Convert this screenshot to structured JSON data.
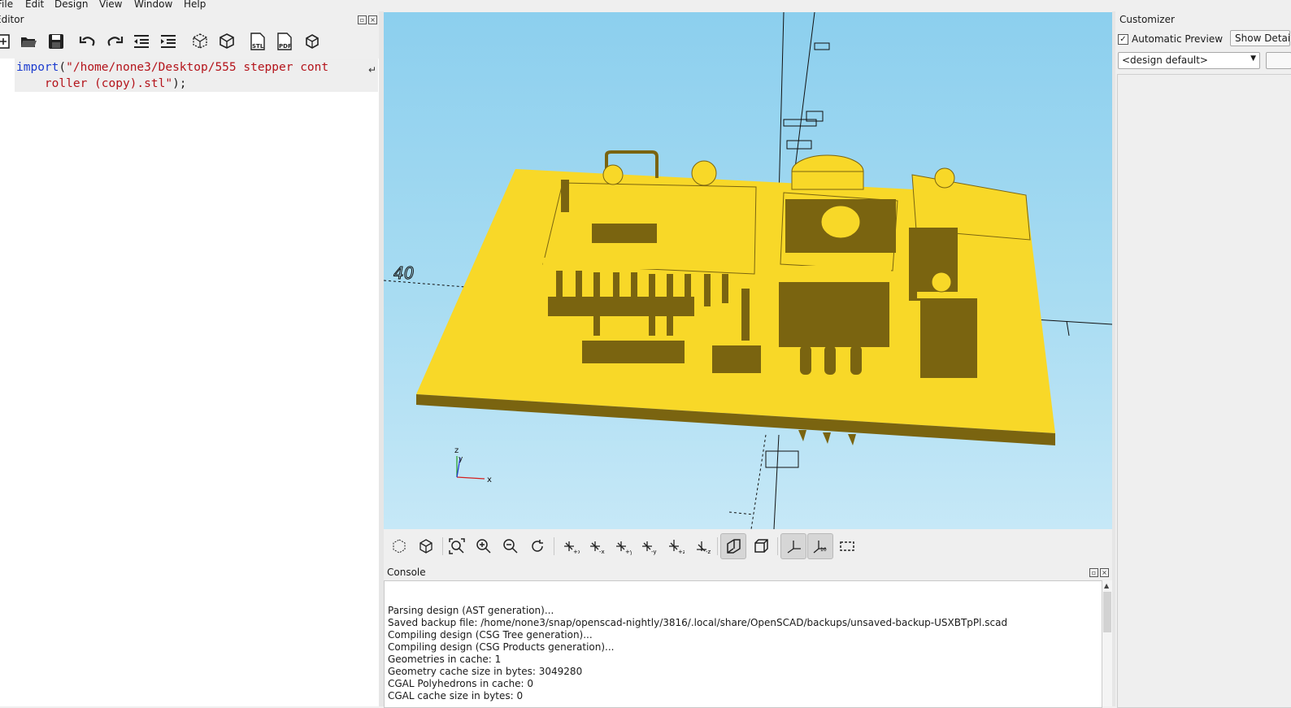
{
  "menu": [
    "File",
    "Edit",
    "Design",
    "View",
    "Window",
    "Help"
  ],
  "editor": {
    "title": "Editor",
    "code_kw": "import",
    "code_str": "\"/home/none3/Desktop/555 stepper cont\n    roller (copy).stl\"",
    "code_tail": ");",
    "toolbar": [
      "new-file-icon",
      "open-file-icon",
      "save-icon",
      "undo-icon",
      "redo-icon",
      "unindent-icon",
      "indent-icon",
      "preview-icon",
      "render-icon",
      "export-stl-icon",
      "export-pdf-icon",
      "send-to-print-icon"
    ],
    "toolbar_labels": {
      "stl": "STL",
      "pdf": "PDF"
    }
  },
  "viewport": {
    "axis_label_40": "40",
    "axis_x": "x",
    "axis_y": "y",
    "axis_z": "z",
    "model_color": "#f8d828",
    "shade_color": "#7a6410",
    "background_top": "#8ccfee",
    "background_bottom": "#c6e8f7"
  },
  "view_toolbar": [
    "preview-icon",
    "render-icon",
    "view-all-icon",
    "zoom-in-icon",
    "zoom-out-icon",
    "reset-view-icon",
    "view-right-icon",
    "view-left-icon",
    "view-back-icon",
    "view-front-icon",
    "view-top-icon",
    "view-bottom-icon",
    "perspective-icon",
    "orthogonal-icon",
    "show-axes-icon",
    "show-scale-icon",
    "show-edges-icon"
  ],
  "console": {
    "title": "Console",
    "lines": [
      "Parsing design (AST generation)...",
      "Saved backup file: /home/none3/snap/openscad-nightly/3816/.local/share/OpenSCAD/backups/unsaved-backup-USXBTpPl.scad",
      "Compiling design (CSG Tree generation)...",
      "Compiling design (CSG Products generation)...",
      "Geometries in cache: 1",
      "Geometry cache size in bytes: 3049280",
      "CGAL Polyhedrons in cache: 0",
      "CGAL cache size in bytes: 0"
    ]
  },
  "customizer": {
    "title": "Customizer",
    "auto_preview_label": "Automatic Preview",
    "auto_preview_checked": true,
    "show_details_label": "Show Details",
    "preset_value": "<design default>"
  }
}
